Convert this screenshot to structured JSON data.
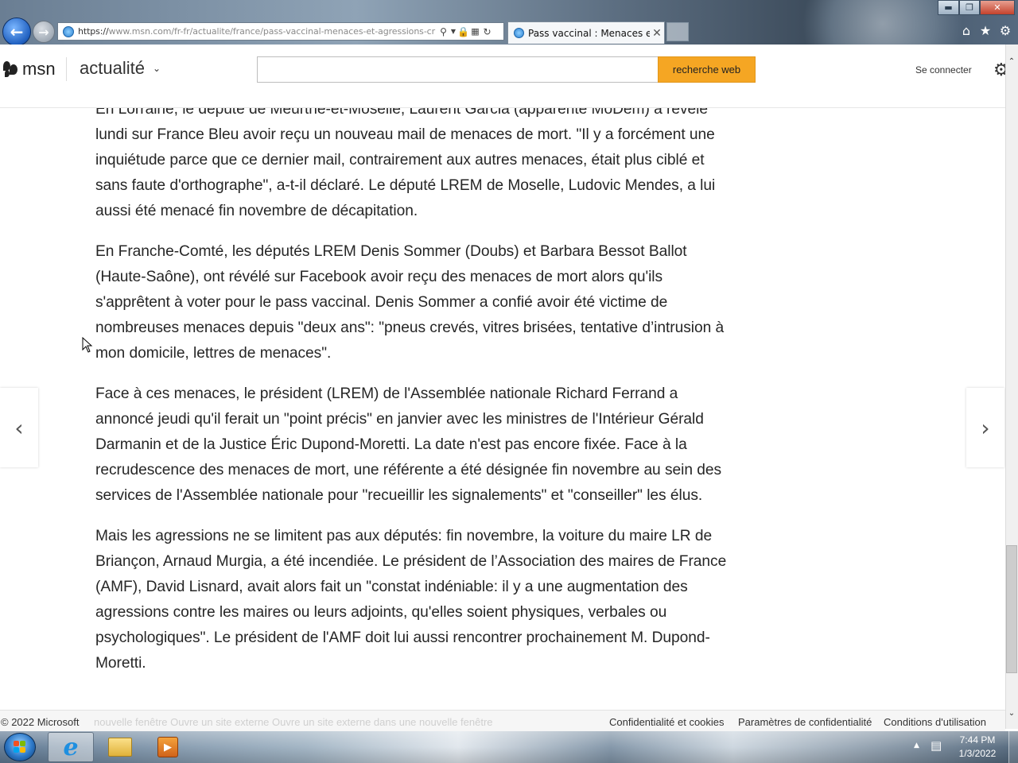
{
  "browser": {
    "url_prefix": "https://",
    "url_rest": "www.msn.com/fr-fr/actualite/france/pass-vaccinal-menaces-et-agressions-cr",
    "tab_title": "Pass vaccinal : Menaces et ...",
    "icons": {
      "back": "back-arrow-icon",
      "forward": "forward-arrow-icon",
      "search": "search-icon",
      "lock": "lock-icon",
      "refresh": "refresh-icon",
      "home": "home-icon",
      "favorites": "star-icon",
      "tools": "gear-icon"
    }
  },
  "header": {
    "logo_text": "msn",
    "section": "actualité",
    "search_placeholder": "",
    "search_button": "recherche web",
    "signin": "Se connecter",
    "accent_color": "#f5a623"
  },
  "article": {
    "paragraphs": [
      "En Lorraine, le député de Meurthe-et-Moselle, Laurent Garcia (apparenté MoDem) a révélé lundi sur France Bleu avoir reçu un nouveau mail de menaces de mort. \"Il y a forcément une inquiétude parce que ce dernier mail, contrairement aux autres menaces, était plus ciblé et sans faute d'orthographe\", a-t-il déclaré. Le député LREM de Moselle, Ludovic Mendes, a lui aussi été menacé fin novembre de décapitation.",
      "En Franche-Comté, les députés LREM Denis Sommer (Doubs) et Barbara Bessot Ballot (Haute-Saône), ont révélé sur Facebook avoir reçu des menaces de mort alors qu'ils s'apprêtent à voter pour le pass vaccinal. Denis Sommer a confié avoir été victime de nombreuses menaces depuis \"deux ans\": \"pneus crevés, vitres brisées, tentative d’intrusion à mon domicile, lettres de menaces\".",
      "Face à ces menaces, le président (LREM) de l'Assemblée nationale Richard Ferrand a annoncé jeudi qu'il ferait un \"point précis\" en janvier avec les ministres de l'Intérieur Gérald Darmanin et de la Justice Éric Dupond-Moretti. La date n'est pas encore fixée. Face à la recrudescence des menaces de mort, une référente a été désignée fin novembre au sein des services de l'Assemblée nationale pour \"recueillir les signalements\" et \"conseiller\" les élus.",
      "Mais les agressions ne se limitent pas aux députés: fin novembre, la voiture du maire LR de Briançon, Arnaud Murgia, a été incendiée. Le président de l’Association des maires de France (AMF), David Lisnard, avait alors fait un \"constat indéniable: il y a une augmentation des agressions contre les maires ou leurs adjoints, qu'elles soient physiques, verbales ou psychologiques\". Le président de l'AMF doit lui aussi rencontrer prochainement M. Dupond-Moretti."
    ]
  },
  "footer": {
    "copyright": "© 2022 Microsoft",
    "ghost_text": "nouvelle fenêtre Ouvre un site externe Ouvre un site externe dans une nouvelle fenêtre",
    "links": [
      "Confidentialité et cookies",
      "Paramètres de confidentialité",
      "Conditions d'utilisation"
    ]
  },
  "taskbar": {
    "time": "7:44 PM",
    "date": "1/3/2022"
  }
}
